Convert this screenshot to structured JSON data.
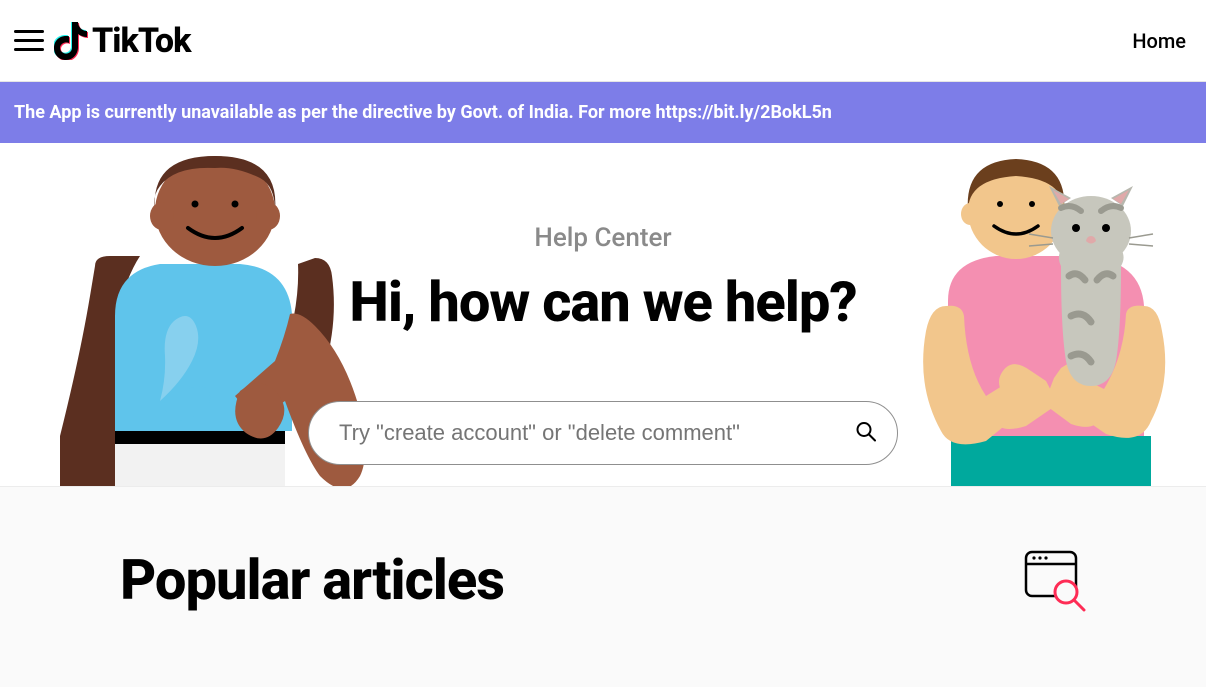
{
  "header": {
    "brand": "TikTok",
    "home": "Home"
  },
  "banner": {
    "text": "The App is currently unavailable as per the directive by Govt. of India. For more https://bit.ly/2BokL5n"
  },
  "hero": {
    "label": "Help Center",
    "title": "Hi, how can we help?",
    "search_placeholder": "Try \"create account\" or \"delete comment\""
  },
  "popular": {
    "title": "Popular articles"
  }
}
